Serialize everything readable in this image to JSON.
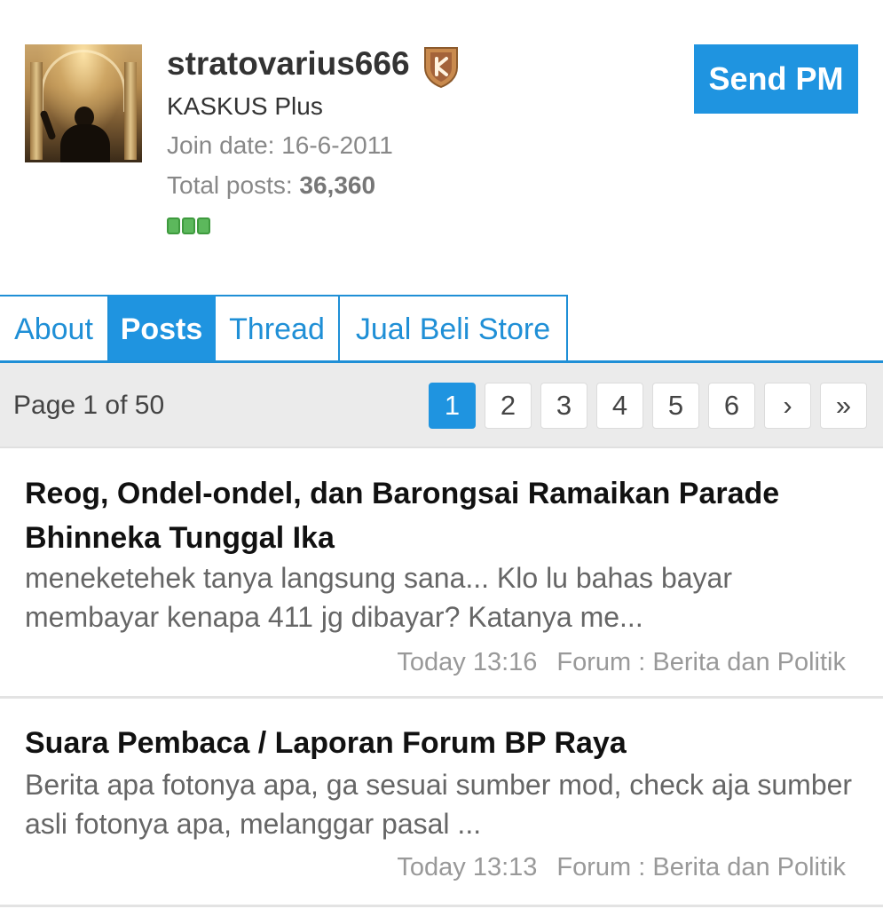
{
  "profile": {
    "username": "stratovarius666",
    "rank": "KASKUS Plus",
    "join_date": "Join date: 16-6-2011",
    "total_posts_label": "Total posts: ",
    "total_posts_value": "36,360",
    "badge_icon": "kaskus-shield-icon",
    "reputation_bars": 3,
    "send_pm_label": "Send PM"
  },
  "tabs": [
    {
      "label": "About",
      "active": false
    },
    {
      "label": "Posts",
      "active": true
    },
    {
      "label": "Thread",
      "active": false
    },
    {
      "label": "Jual Beli Store",
      "active": false
    }
  ],
  "pager": {
    "label": "Page 1 of 50",
    "pages": [
      "1",
      "2",
      "3",
      "4",
      "5",
      "6",
      "›",
      "»"
    ],
    "current": "1"
  },
  "posts": [
    {
      "title": "Reog, Ondel-ondel, dan Barongsai Ramaikan Parade Bhinneka Tunggal Ika",
      "excerpt": "meneketehek tanya langsung sana... Klo lu bahas bayar membayar kenapa 411 jg dibayar? Katanya me...",
      "time": "Today 13:16",
      "forum": "Forum : Berita dan Politik"
    },
    {
      "title": "Suara Pembaca / Laporan Forum BP Raya",
      "excerpt": "Berita apa fotonya apa, ga sesuai sumber mod, check aja sumber asli fotonya apa, melanggar pasal ...",
      "time": "Today 13:13",
      "forum": "Forum : Berita dan Politik"
    }
  ],
  "colors": {
    "accent": "#1f94e0",
    "reputation": "#5cb85c"
  }
}
